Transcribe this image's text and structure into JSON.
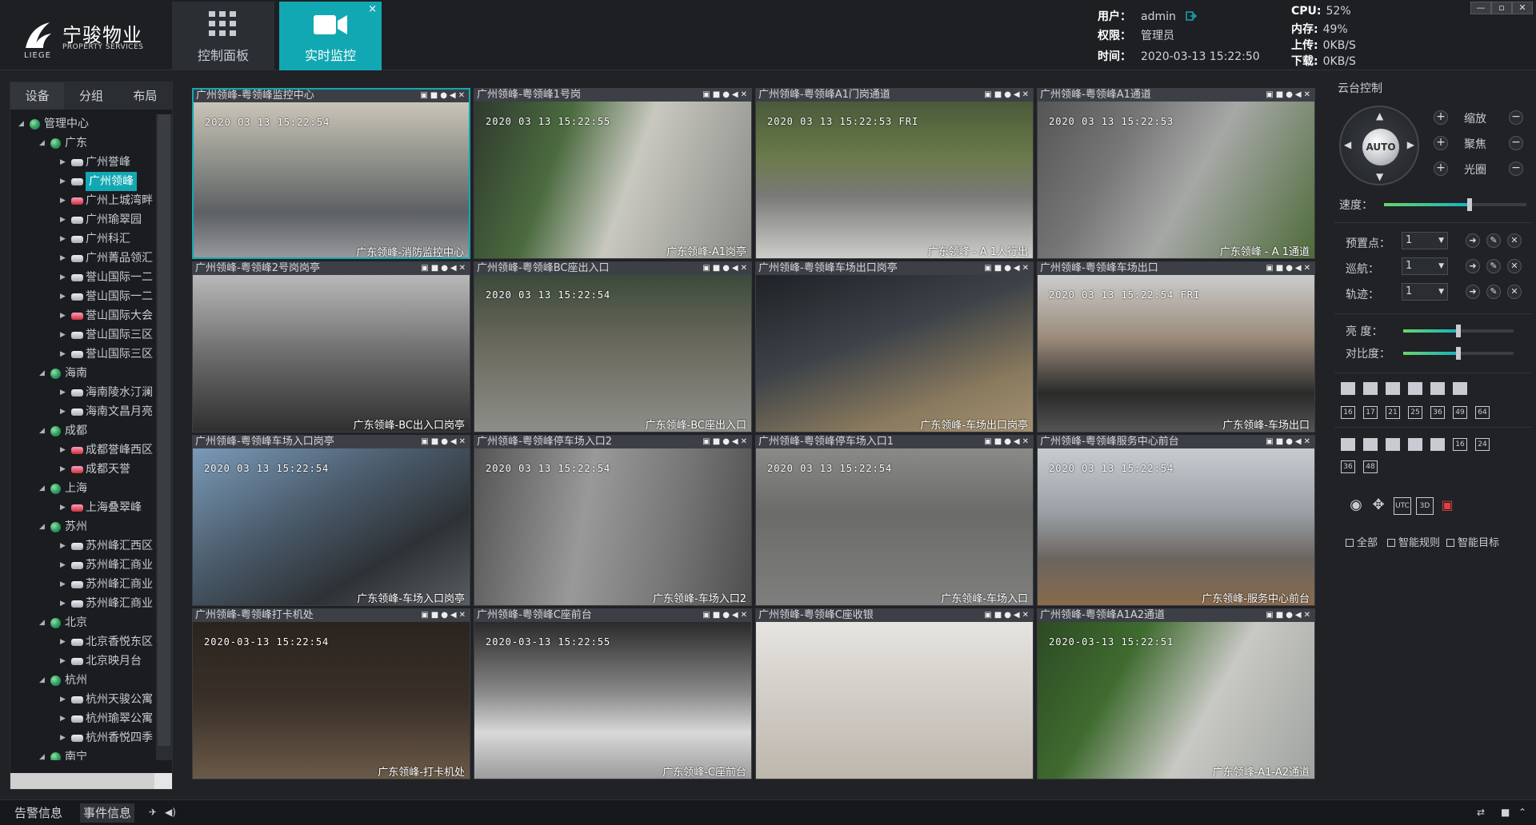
{
  "app": {
    "logo_name": "宁骏物业",
    "logo_sub": "PROPERTY SERVICES",
    "logo_brand": "LIEGE"
  },
  "nav": [
    {
      "label": "控制面板",
      "icon": "grid-icon",
      "active": false
    },
    {
      "label": "实时监控",
      "icon": "camera-icon",
      "active": true,
      "close": "×"
    }
  ],
  "header_info": {
    "user_label": "用户：",
    "user": "admin",
    "role_label": "权限：",
    "role": "管理员",
    "time_label": "时间：",
    "time": "2020-03-13 15:22:50"
  },
  "stats": {
    "cpu_label": "CPU:",
    "cpu": "52%",
    "mem_label": "内存:",
    "mem": "49%",
    "up_label": "上传:",
    "up": "0KB/S",
    "down_label": "下载:",
    "down": "0KB/S"
  },
  "window_buttons": [
    "—",
    "▫",
    "✕"
  ],
  "left_tabs": [
    "设备",
    "分组",
    "布局"
  ],
  "tree": [
    {
      "level": 0,
      "type": "globe",
      "label": "管理中心",
      "expanded": true
    },
    {
      "level": 1,
      "type": "globe",
      "label": "广东",
      "expanded": true
    },
    {
      "level": 2,
      "type": "cam",
      "label": "广州誉峰"
    },
    {
      "level": 2,
      "type": "cam",
      "label": "广州领峰",
      "selected": true
    },
    {
      "level": 2,
      "type": "camred",
      "label": "广州上城湾畔"
    },
    {
      "level": 2,
      "type": "cam",
      "label": "广州瑜翠园"
    },
    {
      "level": 2,
      "type": "cam",
      "label": "广州科汇"
    },
    {
      "level": 2,
      "type": "cam",
      "label": "广州菁品领汇"
    },
    {
      "level": 2,
      "type": "cam",
      "label": "誉山国际一二"
    },
    {
      "level": 2,
      "type": "cam",
      "label": "誉山国际一二"
    },
    {
      "level": 2,
      "type": "camred",
      "label": "誉山国际大会"
    },
    {
      "level": 2,
      "type": "cam",
      "label": "誉山国际三区"
    },
    {
      "level": 2,
      "type": "cam",
      "label": "誉山国际三区"
    },
    {
      "level": 1,
      "type": "globe",
      "label": "海南",
      "expanded": true
    },
    {
      "level": 2,
      "type": "cam",
      "label": "海南陵水汀澜"
    },
    {
      "level": 2,
      "type": "cam",
      "label": "海南文昌月亮"
    },
    {
      "level": 1,
      "type": "globe",
      "label": "成都",
      "expanded": true
    },
    {
      "level": 2,
      "type": "camred",
      "label": "成都誉峰西区"
    },
    {
      "level": 2,
      "type": "camred",
      "label": "成都天誉"
    },
    {
      "level": 1,
      "type": "globe",
      "label": "上海",
      "expanded": true
    },
    {
      "level": 2,
      "type": "camred",
      "label": "上海叠翠峰"
    },
    {
      "level": 1,
      "type": "globe",
      "label": "苏州",
      "expanded": true
    },
    {
      "level": 2,
      "type": "cam",
      "label": "苏州峰汇西区"
    },
    {
      "level": 2,
      "type": "cam",
      "label": "苏州峰汇商业"
    },
    {
      "level": 2,
      "type": "cam",
      "label": "苏州峰汇商业"
    },
    {
      "level": 2,
      "type": "cam",
      "label": "苏州峰汇商业"
    },
    {
      "level": 1,
      "type": "globe",
      "label": "北京",
      "expanded": true
    },
    {
      "level": 2,
      "type": "cam",
      "label": "北京香悦东区"
    },
    {
      "level": 2,
      "type": "cam",
      "label": "北京映月台"
    },
    {
      "level": 1,
      "type": "globe",
      "label": "杭州",
      "expanded": true
    },
    {
      "level": 2,
      "type": "cam",
      "label": "杭州天骏公寓"
    },
    {
      "level": 2,
      "type": "cam",
      "label": "杭州瑜翠公寓"
    },
    {
      "level": 2,
      "type": "cam",
      "label": "杭州香悦四季"
    },
    {
      "level": 1,
      "type": "globe",
      "label": "南宁",
      "expanded": true
    }
  ],
  "cameras": [
    {
      "title": "广州领峰-粤领峰监控中心",
      "timestamp": "2020 03 13 15:22:54",
      "label": "广东领峰-消防监控中心",
      "selected": true
    },
    {
      "title": "广州领峰-粤领峰1号岗",
      "timestamp": "2020 03 13 15:22:55",
      "label": "广东领峰-A1岗亭"
    },
    {
      "title": "广州领峰-粤领峰A1门岗通道",
      "timestamp": "2020 03 13 15:22:53 FRI",
      "label": "广东领峰 - A 1人行出"
    },
    {
      "title": "广州领峰-粤领峰A1通道",
      "timestamp": "2020 03 13 15:22:53",
      "label": "广东领峰 - A 1通道"
    },
    {
      "title": "广州领峰-粤领峰2号岗岗亭",
      "timestamp": "",
      "label": "广东领峰-BC出入口岗亭"
    },
    {
      "title": "广州领峰-粤领峰BC座出入口",
      "timestamp": "2020 03 13 15:22:54",
      "label": "广东领峰-BC座出入口"
    },
    {
      "title": "广州领峰-粤领峰车场出口岗亭",
      "timestamp": "",
      "label": "广东领峰-车场出口岗亭"
    },
    {
      "title": "广州领峰-粤领峰车场出口",
      "timestamp": "2020 03 13 15:22:54 FRI",
      "label": "广东领峰-车场出口"
    },
    {
      "title": "广州领峰-粤领峰车场入口岗亭",
      "timestamp": "2020 03 13 15:22:54",
      "label": "广东领峰-车场入口岗亭"
    },
    {
      "title": "广州领峰-粤领峰停车场入口2",
      "timestamp": "2020 03 13 15:22:54",
      "label": "广东领峰-车场入口2"
    },
    {
      "title": "广州领峰-粤领峰停车场入口1",
      "timestamp": "2020 03 13 15:22:54",
      "label": "广东领峰-车场入口"
    },
    {
      "title": "广州领峰-粤领峰服务中心前台",
      "timestamp": "2020 03 13 15:22:54",
      "label": "广东领峰-服务中心前台"
    },
    {
      "title": "广州领峰-粤领峰打卡机处",
      "timestamp": "2020-03-13 15:22:54",
      "label": "广东领峰-打卡机处"
    },
    {
      "title": "广州领峰-粤领峰C座前台",
      "timestamp": "2020-03-13 15:22:55",
      "label": "广东领峰-C座前台"
    },
    {
      "title": "广州领峰-粤领峰C座收银",
      "timestamp": "",
      "label": ""
    },
    {
      "title": "广州领峰-粤领峰A1A2通道",
      "timestamp": "2020-03-13 15:22:51",
      "label": "广东领峰-A1-A2通道"
    }
  ],
  "tile_icons": "▣■●◀✕",
  "ptz": {
    "title": "云台控制",
    "auto": "AUTO",
    "zoom": "缩放",
    "focus": "聚焦",
    "iris": "光圈",
    "speed_label": "速度：",
    "speed_level": 0.6,
    "preset_label": "预置点：",
    "preset_value": "1",
    "cruise_label": "巡航：",
    "cruise_value": "1",
    "track_label": "轨迹：",
    "track_value": "1",
    "brightness_label": "亮  度：",
    "brightness_level": 0.5,
    "contrast_label": "对比度：",
    "contrast_level": 0.5
  },
  "layout_numbers": [
    "16",
    "17",
    "21",
    "25",
    "36",
    "49",
    "64"
  ],
  "layout_numbers2": [
    "16",
    "24",
    "36",
    "48"
  ],
  "tools": [
    "UTC",
    "3D"
  ],
  "checkboxes": [
    "全部",
    "智能规则",
    "智能目标"
  ],
  "footer": {
    "alarm": "告警信息",
    "event": "事件信息"
  },
  "colors": {
    "accent": "#12a8b3",
    "bg": "#202226"
  }
}
